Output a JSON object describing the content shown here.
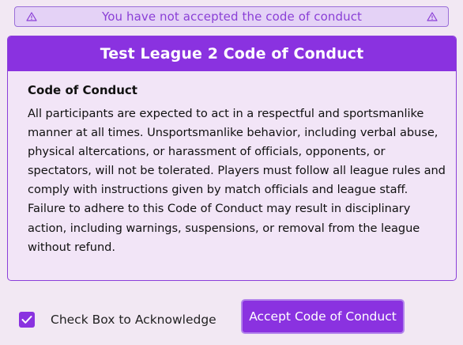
{
  "banner": {
    "text": "You have not accepted the code of conduct",
    "left_icon": "warning-triangle-icon",
    "right_icon": "warning-triangle-icon",
    "color": "#8a3fd6"
  },
  "panel": {
    "title": "Test League 2 Code of Conduct",
    "subtitle": "Code of Conduct",
    "body": "All participants are expected to act in a respectful and sportsmanlike manner at all times. Unsportsmanlike behavior, including verbal abuse, physical altercations, or harassment of officials, opponents, or spectators, will not be tolerated. Players must follow all league rules and comply with instructions given by match officials and league staff. Failure to adhere to this Code of Conduct may result in disciplinary action, including warnings, suspensions, or removal from the league without refund.",
    "accent_color": "#8a32e0"
  },
  "footer": {
    "checkbox_checked": true,
    "checkbox_label": "Check Box to Acknowledge",
    "accept_button_label": "Accept Code of Conduct"
  }
}
